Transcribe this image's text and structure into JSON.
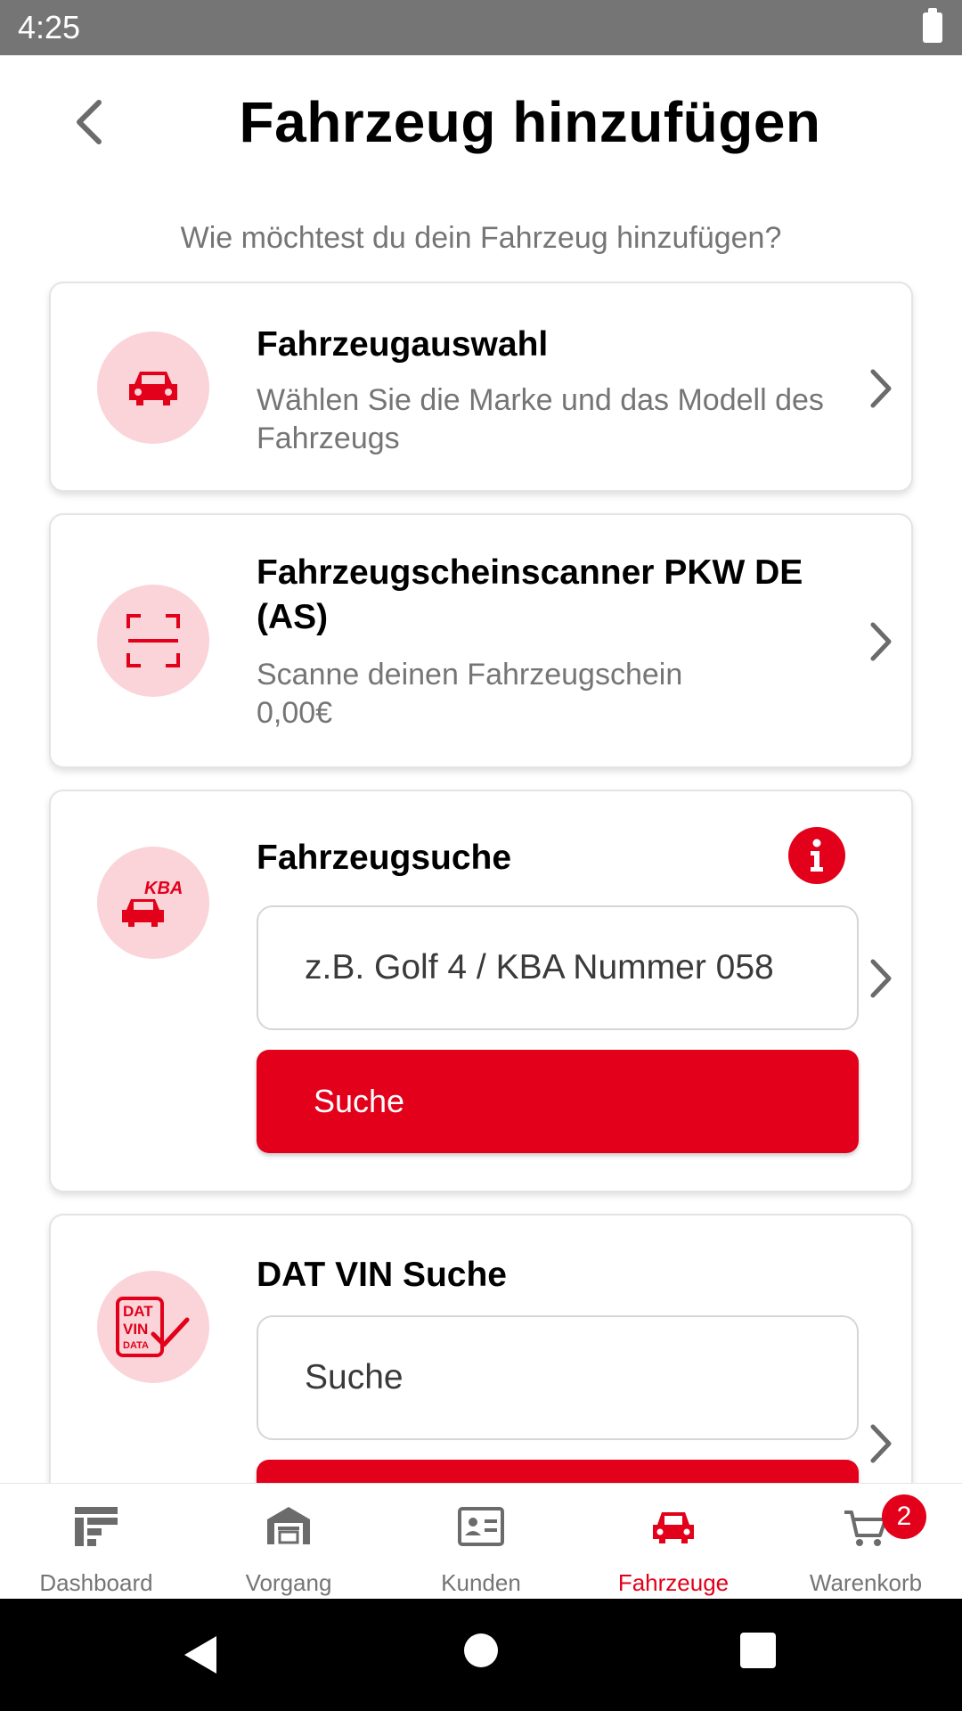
{
  "status_bar": {
    "time": "4:25"
  },
  "header": {
    "title": "Fahrzeug hinzufügen",
    "back_icon": "chevron-left-icon"
  },
  "subtitle": "Wie möchtest du dein Fahrzeug hinzufügen?",
  "cards": [
    {
      "title": "Fahrzeugauswahl",
      "description": "Wählen Sie die Marke und das Modell des Fahrzeugs",
      "icon": "car-icon"
    },
    {
      "title": "Fahrzeugscheinscanner PKW DE (AS)",
      "description": "Scanne deinen Fahrzeugschein",
      "price": "0,00€",
      "icon": "scan-icon"
    },
    {
      "title": "Fahrzeugsuche",
      "icon": "kba-car-icon",
      "icon_text": "KBA",
      "input_placeholder": "z.B. Golf 4 / KBA Nummer 058",
      "input_value": "",
      "button_label": "Suche",
      "info_icon": "info-icon"
    },
    {
      "title": "DAT VIN Suche",
      "icon": "dat-vin-icon",
      "icon_lines": [
        "DAT",
        "VIN",
        "DATA"
      ],
      "input_placeholder": "Suche",
      "input_value": ""
    }
  ],
  "bottom_nav": {
    "items": [
      {
        "label": "Dashboard",
        "icon": "dashboard-icon",
        "active": false
      },
      {
        "label": "Vorgang",
        "icon": "garage-icon",
        "active": false
      },
      {
        "label": "Kunden",
        "icon": "customer-card-icon",
        "active": false
      },
      {
        "label": "Fahrzeuge",
        "icon": "car-icon",
        "active": true
      },
      {
        "label": "Warenkorb",
        "icon": "cart-icon",
        "active": false,
        "badge": "2"
      }
    ]
  },
  "colors": {
    "accent": "#e2001a",
    "icon_bg": "#fad4d8",
    "muted_text": "#757575",
    "status_bar": "#757575"
  }
}
